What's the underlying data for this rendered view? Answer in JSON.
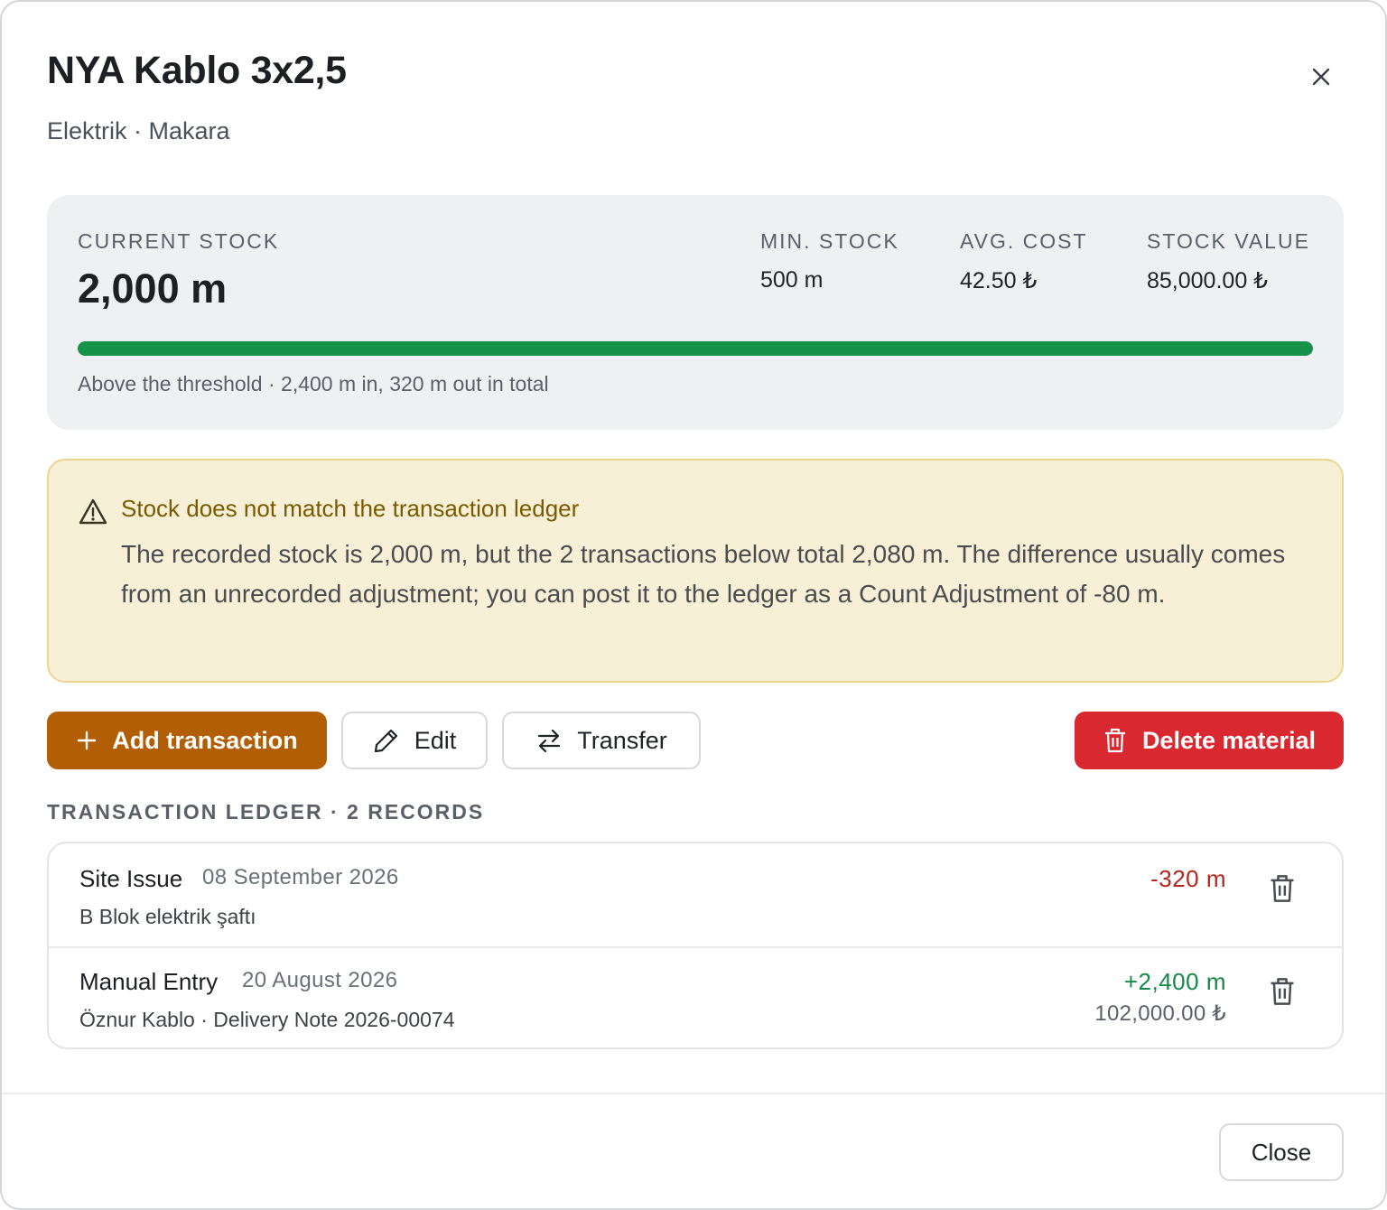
{
  "header": {
    "title": "NYA Kablo 3x2,5",
    "subtitle": "Elektrik · Makara"
  },
  "stock": {
    "current_label": "CURRENT STOCK",
    "current_value": "2,000 m",
    "min_label": "MIN. STOCK",
    "min_value": "500 m",
    "avg_label": "AVG. COST",
    "avg_value": "42.50 ₺",
    "value_label": "STOCK VALUE",
    "value_value": "85,000.00 ₺",
    "bar_fill_fraction": 1.0,
    "bar_color": "#16924b",
    "note": "Above the threshold · 2,400 m in, 320 m out in total"
  },
  "warning": {
    "icon": "warning-triangle-icon",
    "title": "Stock does not match the transaction ledger",
    "text": "The recorded stock is 2,000 m, but the 2 transactions below total 2,080 m. The difference usually comes from an unrecorded adjustment; you can post it to the ledger as a Count Adjustment of -80 m."
  },
  "actions": {
    "add_label": "Add transaction",
    "edit_label": "Edit",
    "transfer_label": "Transfer",
    "delete_label": "Delete material"
  },
  "ledger": {
    "heading": "TRANSACTION LEDGER · 2 RECORDS",
    "rows": [
      {
        "type": "Site Issue",
        "date": "08 September 2026",
        "description": "B Blok elektrik şaftı",
        "amount": "-320 m",
        "subamount": ""
      },
      {
        "type": "Manual Entry",
        "date": "20 August 2026",
        "description": "Öznur Kablo · Delivery Note 2026-00074",
        "amount": "+2,400 m",
        "subamount": "102,000.00 ₺"
      }
    ]
  },
  "footer": {
    "close_label": "Close"
  },
  "colors": {
    "primary": "#b25e04",
    "danger": "#d9282f",
    "positive": "#16884a",
    "negative": "#b3261e",
    "warning_bg": "#f8f0d6"
  }
}
